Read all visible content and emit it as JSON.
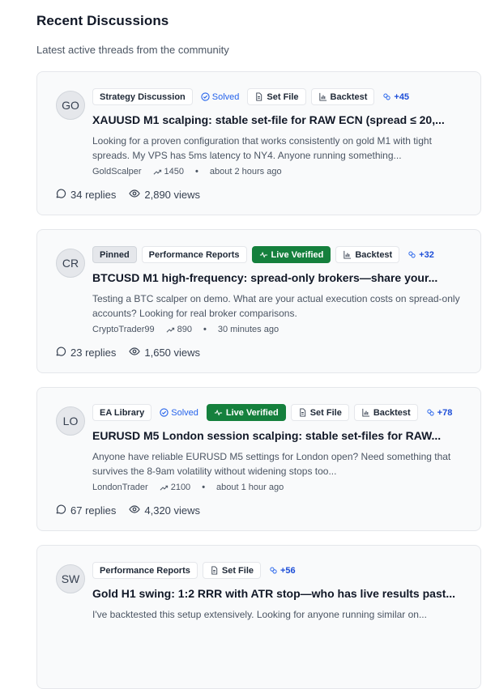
{
  "header": {
    "title": "Recent Discussions",
    "subtitle": "Latest active threads from the community"
  },
  "threads": [
    {
      "initials": "GO",
      "tags": [
        {
          "label": "Strategy Discussion",
          "kind": "category"
        },
        {
          "label": "Solved",
          "kind": "solved"
        },
        {
          "label": "Set File",
          "kind": "setfile"
        },
        {
          "label": "Backtest",
          "kind": "backtest"
        },
        {
          "label": "+45",
          "kind": "links"
        }
      ],
      "title": "XAUUSD M1 scalping: stable set-file for RAW ECN (spread ≤ 20,...",
      "excerpt": "Looking for a proven configuration that works consistently on gold M1 with tight spreads. My VPS has 5ms latency to NY4. Anyone running something...",
      "author": "GoldScalper",
      "reputation": "1450",
      "time": "about 2 hours ago",
      "replies": "34 replies",
      "views": "2,890 views"
    },
    {
      "initials": "CR",
      "tags": [
        {
          "label": "Pinned",
          "kind": "pinned"
        },
        {
          "label": "Performance Reports",
          "kind": "category"
        },
        {
          "label": "Live Verified",
          "kind": "live"
        },
        {
          "label": "Backtest",
          "kind": "backtest"
        },
        {
          "label": "+32",
          "kind": "links"
        }
      ],
      "title": "BTCUSD M1 high-frequency: spread-only brokers—share your...",
      "excerpt": "Testing a BTC scalper on demo. What are your actual execution costs on spread-only accounts? Looking for real broker comparisons.",
      "author": "CryptoTrader99",
      "reputation": "890",
      "time": "30 minutes ago",
      "replies": "23 replies",
      "views": "1,650 views"
    },
    {
      "initials": "LO",
      "tags": [
        {
          "label": "EA Library",
          "kind": "category"
        },
        {
          "label": "Solved",
          "kind": "solved"
        },
        {
          "label": "Live Verified",
          "kind": "live"
        },
        {
          "label": "Set File",
          "kind": "setfile"
        },
        {
          "label": "Backtest",
          "kind": "backtest"
        },
        {
          "label": "+78",
          "kind": "links"
        }
      ],
      "title": "EURUSD M5 London session scalping: stable set-files for RAW...",
      "excerpt": "Anyone have reliable EURUSD M5 settings for London open? Need something that survives the 8-9am volatility without widening stops too...",
      "author": "LondonTrader",
      "reputation": "2100",
      "time": "about 1 hour ago",
      "replies": "67 replies",
      "views": "4,320 views"
    },
    {
      "initials": "SW",
      "tags": [
        {
          "label": "Performance Reports",
          "kind": "category"
        },
        {
          "label": "Set File",
          "kind": "setfile"
        },
        {
          "label": "+56",
          "kind": "links"
        }
      ],
      "title": "Gold H1 swing: 1:2 RRR with ATR stop—who has live results past...",
      "excerpt": "I've backtested this setup extensively. Looking for anyone running similar on...",
      "author": "",
      "reputation": "",
      "time": "",
      "replies": "",
      "views": ""
    }
  ]
}
